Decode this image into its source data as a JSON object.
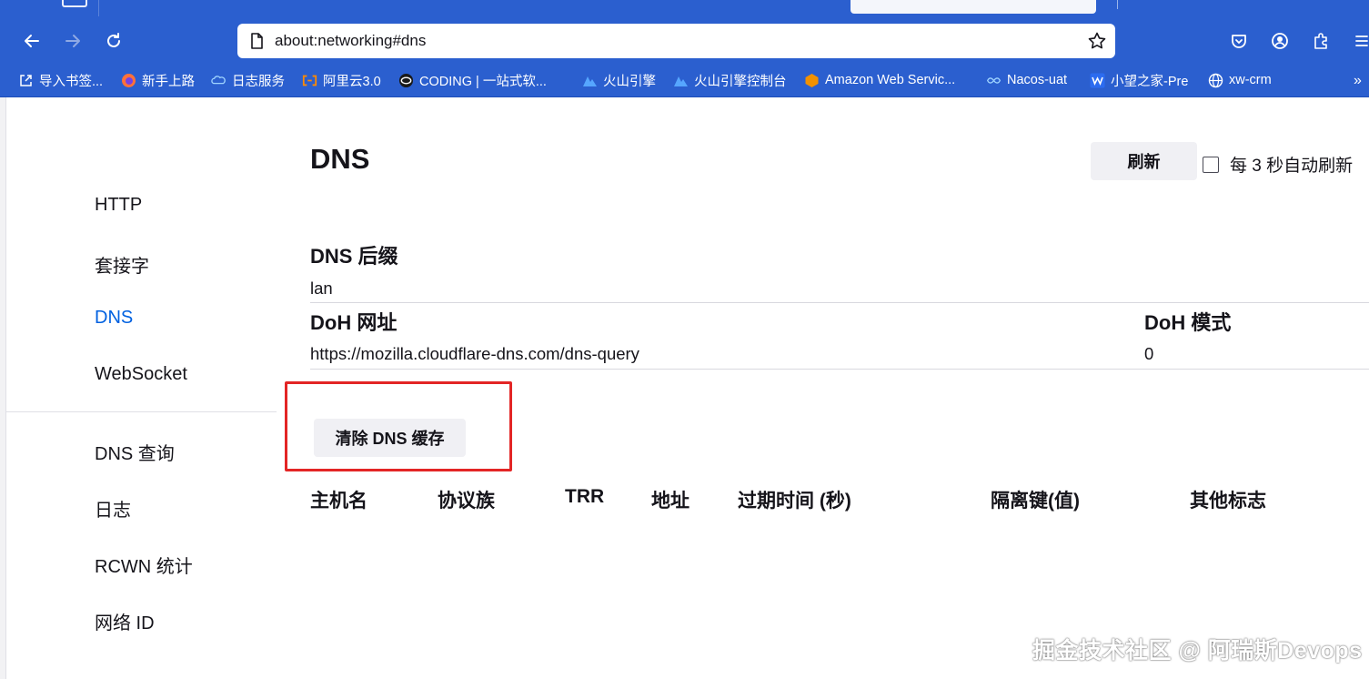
{
  "browser": {
    "url": "about:networking#dns",
    "bookmarks": [
      {
        "label": "导入书签...",
        "icon": "import-icon"
      },
      {
        "label": "新手上路",
        "icon": "firefox-icon"
      },
      {
        "label": "日志服务",
        "icon": "cloud-icon"
      },
      {
        "label": "阿里云3.0",
        "icon": "aliyun-icon"
      },
      {
        "label": "CODING | 一站式软...",
        "icon": "coding-icon"
      },
      {
        "label": "火山引擎",
        "icon": "volcano-icon"
      },
      {
        "label": "火山引擎控制台",
        "icon": "volcano-icon"
      },
      {
        "label": "Amazon Web Servic...",
        "icon": "aws-icon"
      },
      {
        "label": "Nacos-uat",
        "icon": "nacos-icon"
      },
      {
        "label": "小望之家-Pre",
        "icon": "wang-icon"
      },
      {
        "label": "xw-crm",
        "icon": "globe-icon"
      }
    ],
    "more_label": "»"
  },
  "sidebar": {
    "items": [
      {
        "label": "HTTP",
        "active": false
      },
      {
        "label": "套接字",
        "active": false
      },
      {
        "label": "DNS",
        "active": true
      },
      {
        "label": "WebSocket",
        "active": false
      },
      {
        "label": "DNS 查询",
        "active": false
      },
      {
        "label": "日志",
        "active": false
      },
      {
        "label": "RCWN 统计",
        "active": false
      },
      {
        "label": "网络 ID",
        "active": false
      }
    ]
  },
  "main": {
    "title": "DNS",
    "refresh_label": "刷新",
    "auto_refresh_label": "每 3 秒自动刷新",
    "auto_refresh_checked": false,
    "dns_suffix_heading": "DNS 后缀",
    "dns_suffix_value": "lan",
    "doh_url_heading": "DoH 网址",
    "doh_url_value": "https://mozilla.cloudflare-dns.com/dns-query",
    "doh_mode_heading": "DoH 模式",
    "doh_mode_value": "0",
    "clear_cache_label": "清除 DNS 缓存",
    "table_headers": [
      "主机名",
      "协议族",
      "TRR",
      "地址",
      "过期时间 (秒)",
      "隔离键(值)",
      "其他标志"
    ]
  },
  "watermark": "掘金技术社区 @ 阿瑞斯Devops",
  "colors": {
    "chrome_blue": "#2b5fcf",
    "active_link": "#0061e0",
    "highlight_red": "#e32525"
  }
}
